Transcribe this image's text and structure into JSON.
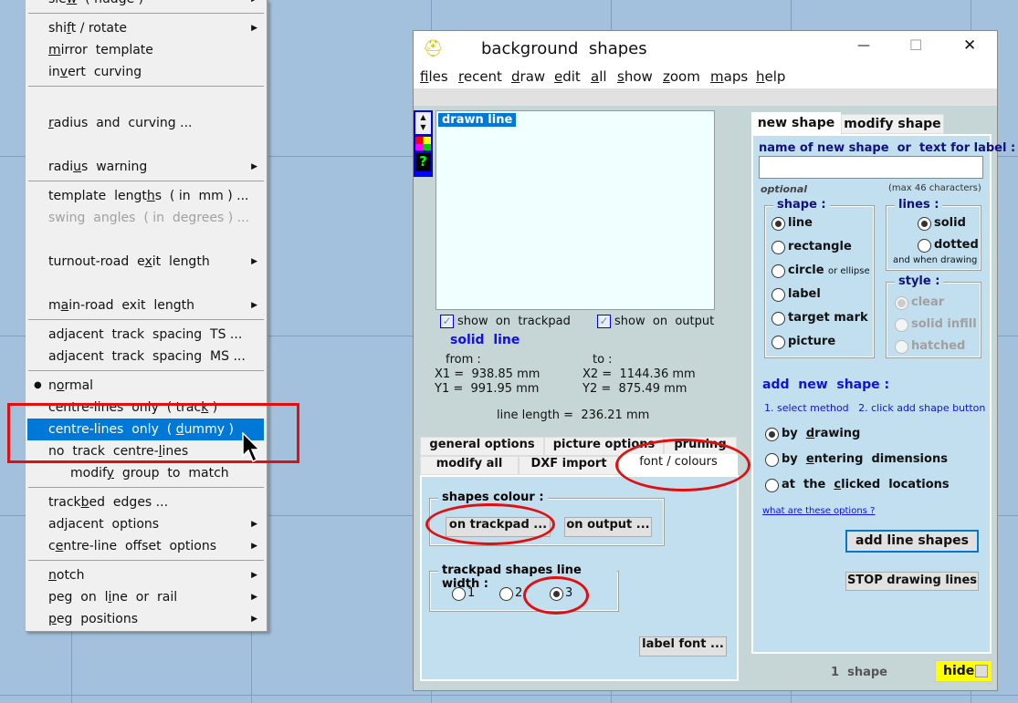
{
  "context_menu": {
    "items": [
      {
        "type": "item",
        "label": "slew  ( nudge )",
        "accel": "w",
        "submenu": true
      },
      {
        "type": "sep"
      },
      {
        "type": "item",
        "label": "shift / rotate",
        "accel": "f",
        "submenu": true
      },
      {
        "type": "item",
        "label": "mirror  template",
        "accel": "m"
      },
      {
        "type": "item",
        "label": "invert  curving",
        "accel": "v"
      },
      {
        "type": "sep"
      },
      {
        "type": "blank"
      },
      {
        "type": "item",
        "label": "radius  and  curving ...",
        "accel": "r"
      },
      {
        "type": "blank"
      },
      {
        "type": "item",
        "label": "radius  warning",
        "accel": "u",
        "submenu": true
      },
      {
        "type": "sep"
      },
      {
        "type": "item",
        "label": "template  lengths  ( in  mm ) ...",
        "accel": "h"
      },
      {
        "type": "item",
        "label": "swing  angles  ( in  degrees ) ...",
        "disabled": true
      },
      {
        "type": "blank"
      },
      {
        "type": "item",
        "label": "turnout-road  exit  length",
        "accel": "x",
        "submenu": true
      },
      {
        "type": "blank"
      },
      {
        "type": "item",
        "label": "main-road  exit  length",
        "accel": "a",
        "submenu": true
      },
      {
        "type": "sep"
      },
      {
        "type": "item",
        "label": "adjacent  track  spacing  TS ..."
      },
      {
        "type": "item",
        "label": "adjacent  track  spacing  MS ..."
      },
      {
        "type": "sep"
      },
      {
        "type": "item",
        "label": "normal",
        "accel": "o",
        "checked": true
      },
      {
        "type": "item",
        "label": "centre-lines  only  ( track )",
        "accel": "k"
      },
      {
        "type": "item",
        "label": "centre-lines  only  ( dummy )",
        "accel": "d",
        "highlighted": true
      },
      {
        "type": "item",
        "label": "no  track  centre-lines",
        "accel": "l"
      },
      {
        "type": "item",
        "label": "modify  group  to  match",
        "accel": "y",
        "indent": true
      },
      {
        "type": "sep"
      },
      {
        "type": "item",
        "label": "trackbed  edges ...",
        "accel": "b"
      },
      {
        "type": "item",
        "label": "adjacent  options",
        "submenu": true
      },
      {
        "type": "item",
        "label": "centre-line  offset  options",
        "accel": "e",
        "submenu": true
      },
      {
        "type": "sep"
      },
      {
        "type": "item",
        "label": "notch",
        "accel": "n",
        "submenu": true
      },
      {
        "type": "item",
        "label": "peg  on  line  or  rail",
        "accel": "i",
        "submenu": true
      },
      {
        "type": "item",
        "label": "peg  positions",
        "accel": "p",
        "submenu": true
      }
    ]
  },
  "window": {
    "title": "background  shapes",
    "controls": {
      "minimize": "—",
      "maximize": "☐",
      "close": "✕"
    },
    "menubar": [
      "files",
      "recent",
      "draw",
      "edit",
      "all",
      "show",
      "zoom",
      "maps",
      "help"
    ],
    "shape_list": {
      "items": [
        "drawn line"
      ]
    },
    "show_on_trackpad": "show  on  trackpad",
    "show_on_output": "show  on  output",
    "line_style": "solid  line",
    "from_label": "from :",
    "to_label": "to :",
    "x1": "X1 =  938.85 mm",
    "y1": "Y1 =  991.95 mm",
    "x2": "X2 =  1144.36 mm",
    "y2": "Y2 =  875.49 mm",
    "line_length": "line length =  236.21 mm",
    "lower_tabs": {
      "row1": [
        "general  options",
        "picture  options",
        "pruning"
      ],
      "row2": [
        "modify  all",
        "DXF  import",
        "font / colours"
      ],
      "active": "font / colours"
    },
    "shapes_colour": "shapes colour :",
    "on_trackpad": "on  trackpad ...",
    "on_output": "on  output ...",
    "line_width_label": "trackpad shapes line width :",
    "line_widths": [
      "1",
      "2",
      "3"
    ],
    "line_width_selected": "3",
    "label_font": "label  font ...",
    "right_tabs": [
      "new  shape",
      "modify  shape"
    ],
    "name_label": "name of new shape  or  text for label :",
    "name_value": "",
    "optional": "optional",
    "max_chars": "(max 46 characters)",
    "shape_group": "shape :",
    "shapes": [
      "line",
      "rectangle",
      "circle",
      "label",
      "target mark",
      "picture"
    ],
    "circle_note": "or ellipse",
    "shape_selected": "line",
    "lines_group": "lines :",
    "lines": [
      "solid",
      "dotted"
    ],
    "lines_selected": "solid",
    "lines_note": "and when drawing",
    "style_group": "style :",
    "styles": [
      "clear",
      "solid infill",
      "hatched"
    ],
    "add_new_shape": "add  new  shape :",
    "instructions": "1. select method   2. click add shape button",
    "methods": [
      "by  drawing",
      "by  entering  dimensions",
      "at  the  clicked  locations"
    ],
    "help_link": "what are these options ?",
    "add_button": "add  line  shapes",
    "stop_button": "STOP  drawing lines",
    "count": "1  shape",
    "hide": "hide"
  },
  "colors": {
    "highlight": "#0078d7",
    "annotation": "#e01010",
    "hide_bg": "#ffff00",
    "blue_text": "#1010e0"
  }
}
